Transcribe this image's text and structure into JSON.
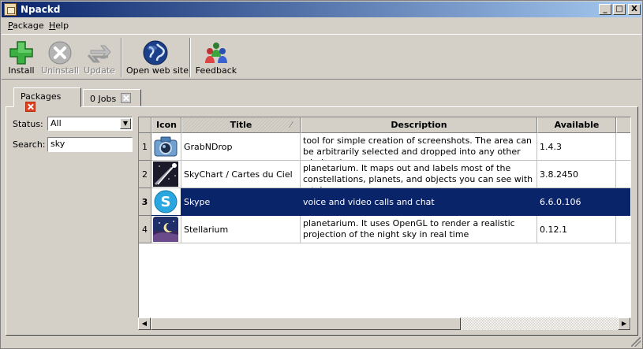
{
  "window": {
    "title": "Npackd",
    "controls": [
      "_",
      "□",
      "X"
    ]
  },
  "menu": [
    {
      "label": "Package",
      "accel_index": 0
    },
    {
      "label": "Help",
      "accel_index": 0
    }
  ],
  "toolbar": {
    "install": "Install",
    "uninstall": "Uninstall",
    "update": "Update",
    "open_web_site": "Open web site",
    "feedback": "Feedback"
  },
  "tabs": {
    "packages": "Packages",
    "jobs": "0 Jobs"
  },
  "filters": {
    "status_label": "Status:",
    "status_value": "All",
    "search_label": "Search:",
    "search_value": "sky"
  },
  "table": {
    "columns": [
      "Icon",
      "Title",
      "Description",
      "Available"
    ],
    "rows": [
      {
        "num": "1",
        "title": "GrabNDrop",
        "description": "tool for simple creation of screenshots. The area can be arbitrarily selected and dropped into any other window (e....",
        "available": "1.4.3",
        "icon": "camera-icon"
      },
      {
        "num": "2",
        "title": "SkyChart / Cartes du Ciel",
        "description": "planetarium. It maps out and labels most of the constellations, planets, and objects you can see with a tel...",
        "available": "3.8.2450",
        "icon": "comet-icon"
      },
      {
        "num": "3",
        "title": "Skype",
        "description": "voice and video calls and chat",
        "available": "6.6.0.106",
        "icon": "skype-icon",
        "selected": true
      },
      {
        "num": "4",
        "title": "Stellarium",
        "description": "planetarium. It uses OpenGL to render a realistic projection of the night sky in real time",
        "available": "0.12.1",
        "icon": "night-sky-icon"
      }
    ]
  },
  "colors": {
    "selection": "#0a246a",
    "titlebar_start": "#0a246a",
    "titlebar_end": "#a6caf0"
  }
}
